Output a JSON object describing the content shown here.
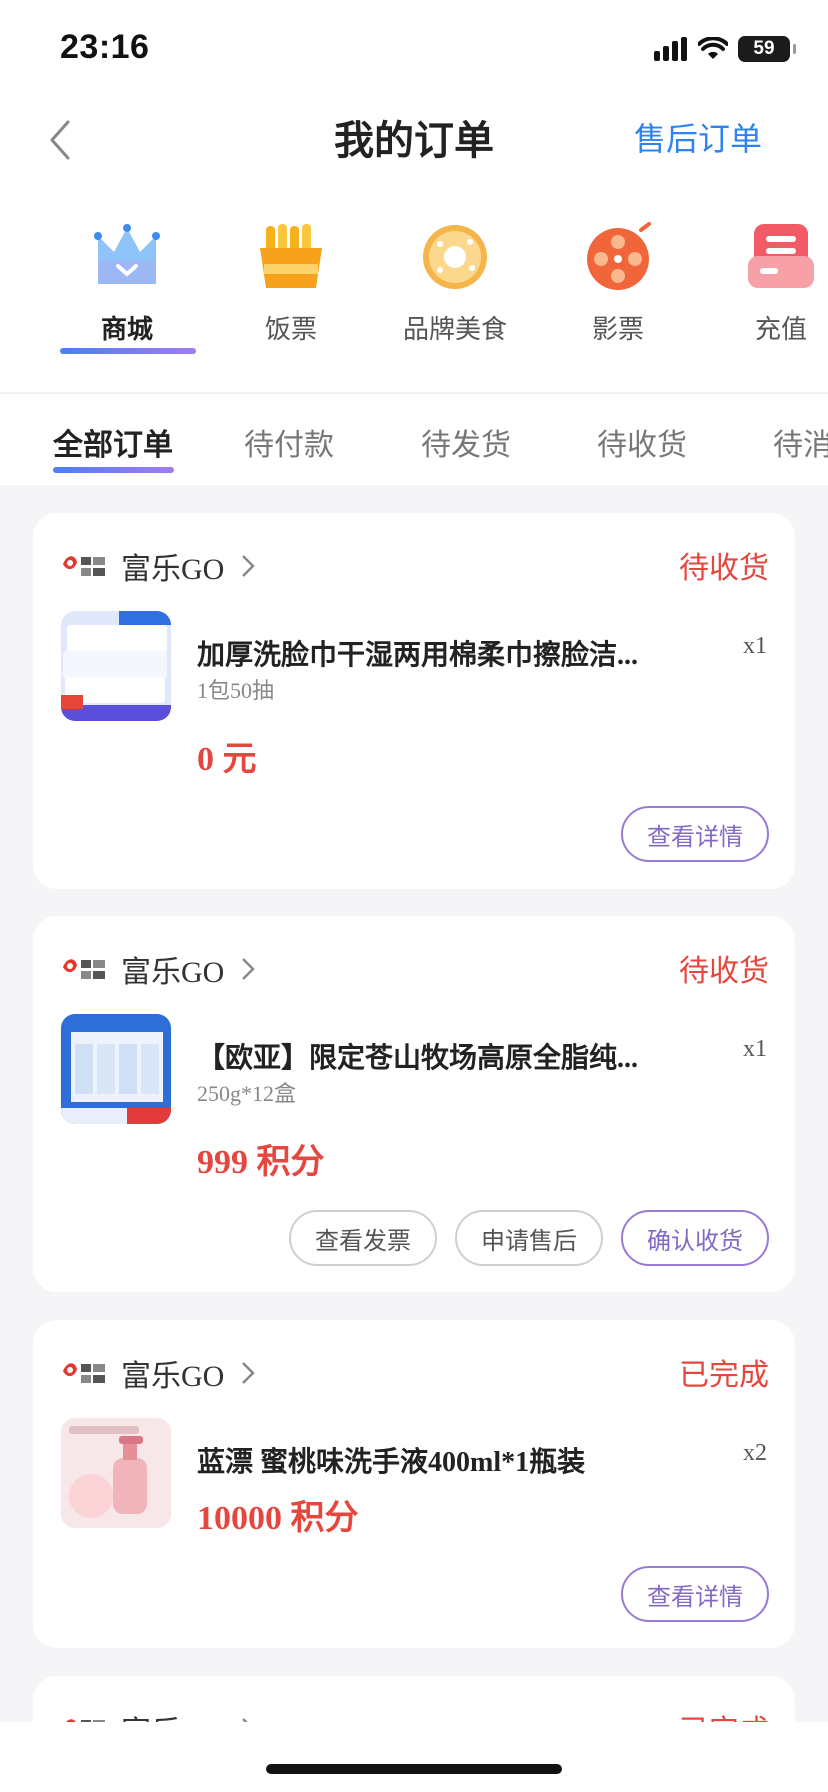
{
  "status_bar": {
    "time": "23:16",
    "battery": "59"
  },
  "nav": {
    "title": "我的订单",
    "after_sales": "售后订单"
  },
  "categories": [
    {
      "label": "商城",
      "icon": "mall-crown-icon",
      "active": true
    },
    {
      "label": "饭票",
      "icon": "meal-ticket-icon"
    },
    {
      "label": "品牌美食",
      "icon": "donut-icon"
    },
    {
      "label": "影票",
      "icon": "film-reel-icon"
    },
    {
      "label": "充值",
      "icon": "recharge-icon"
    }
  ],
  "tabs": [
    {
      "label": "全部订单",
      "active": true
    },
    {
      "label": "待付款"
    },
    {
      "label": "待发货"
    },
    {
      "label": "待收货"
    },
    {
      "label": "待消"
    }
  ],
  "orders": [
    {
      "shop": "富乐GO",
      "status": "待收货",
      "product": "加厚洗脸巾干湿两用棉柔巾擦脸洁...",
      "spec": "1包50抽",
      "qty": "x1",
      "price": "0 元",
      "buttons": [
        "查看详情"
      ]
    },
    {
      "shop": "富乐GO",
      "status": "待收货",
      "product": "【欧亚】限定苍山牧场高原全脂纯...",
      "spec": "250g*12盒",
      "qty": "x1",
      "price": "999 积分",
      "buttons": [
        "查看发票",
        "申请售后",
        "确认收货"
      ]
    },
    {
      "shop": "富乐GO",
      "status": "已完成",
      "product": "蓝漂 蜜桃味洗手液400ml*1瓶装",
      "qty": "x2",
      "price": "10000 积分",
      "buttons": [
        "查看详情"
      ]
    },
    {
      "shop": "富乐GO",
      "status": "已完成"
    }
  ],
  "colors": {
    "accent_red": "#e5473e",
    "link_blue": "#2e83f0",
    "button_purple": "#8468c6"
  }
}
